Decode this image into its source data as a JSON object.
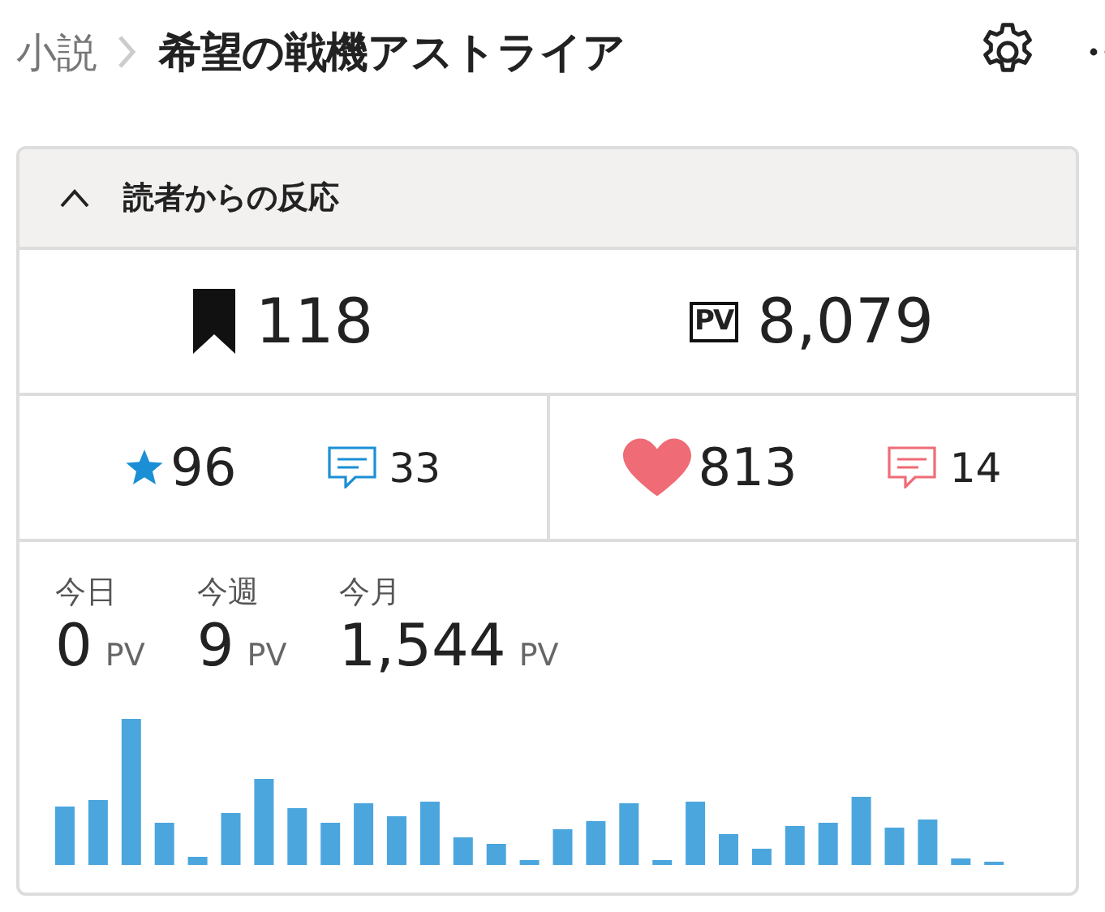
{
  "breadcrumb": {
    "parent": "小説",
    "title": "希望の戦機アストライア"
  },
  "panel": {
    "title": "読者からの反応",
    "expanded": true,
    "totals": [
      {
        "kind": "bookmark",
        "value": "118"
      },
      {
        "kind": "pv",
        "badge": "PV",
        "value": "8,079"
      }
    ],
    "reactions": [
      {
        "kind": "star",
        "value": "96",
        "comments": "33",
        "color": "#1a8fd6"
      },
      {
        "kind": "heart",
        "value": "813",
        "comments": "14",
        "color": "#ef6b75"
      }
    ],
    "periods": [
      {
        "label": "今日",
        "value": "0",
        "unit": "PV"
      },
      {
        "label": "今週",
        "value": "9",
        "unit": "PV"
      },
      {
        "label": "今月",
        "value": "1,544",
        "unit": "PV"
      }
    ]
  }
}
